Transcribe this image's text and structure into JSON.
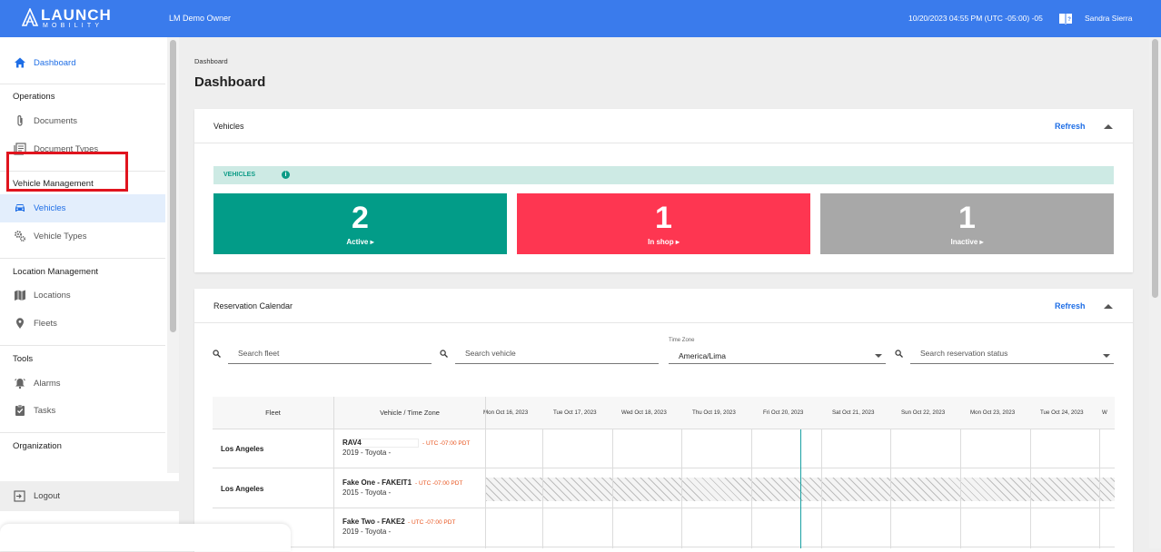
{
  "header": {
    "logo_word": "LAUNCH",
    "logo_sub": "MOBILITY",
    "org": "LM Demo Owner",
    "datetime": "10/20/2023 04:55 PM (UTC -05:00) -05",
    "user": "Sandra Sierra",
    "help_icon": "book-help-icon"
  },
  "sidebar": {
    "dashboard": "Dashboard",
    "sections": {
      "operations": "Operations",
      "vehicle_management": "Vehicle Management",
      "location_management": "Location Management",
      "tools": "Tools",
      "organization": "Organization"
    },
    "items": {
      "documents": "Documents",
      "document_types": "Document Types",
      "vehicles": "Vehicles",
      "vehicle_types": "Vehicle Types",
      "locations": "Locations",
      "fleets": "Fleets",
      "alarms": "Alarms",
      "tasks": "Tasks"
    },
    "logout": "Logout",
    "active": "Vehicles"
  },
  "main": {
    "breadcrumb": "Dashboard",
    "title": "Dashboard",
    "vehicles_card": {
      "title": "Vehicles",
      "refresh": "Refresh",
      "banner": "VEHICLES",
      "stats": [
        {
          "value": "2",
          "label": "Active",
          "color": "#029c88"
        },
        {
          "value": "1",
          "label": "In shop",
          "color": "#fe3651"
        },
        {
          "value": "1",
          "label": "Inactive",
          "color": "#a8a8a8"
        }
      ]
    },
    "calendar_card": {
      "title": "Reservation Calendar",
      "refresh": "Refresh",
      "search_fleet_placeholder": "Search fleet",
      "search_vehicle_placeholder": "Search vehicle",
      "time_zone_label": "Time Zone",
      "time_zone_value": "America/Lima",
      "search_status_placeholder": "Search reservation status",
      "columns": {
        "fleet": "Fleet",
        "vehicle": "Vehicle / Time Zone"
      },
      "days": [
        "Mon Oct 16, 2023",
        "Tue Oct 17, 2023",
        "Wed Oct 18, 2023",
        "Thu Oct 19, 2023",
        "Fri Oct 20, 2023",
        "Sat Oct 21, 2023",
        "Sun Oct 22, 2023",
        "Mon Oct 23, 2023",
        "Tue Oct 24, 2023",
        "W"
      ],
      "rows": [
        {
          "fleet": "Los Angeles",
          "vehicle": "RAV4",
          "tz": "- UTC -07:00 PDT",
          "sub": "2019 - Toyota -"
        },
        {
          "fleet": "Los Angeles",
          "vehicle": "Fake One - FAKEIT1",
          "tz": "- UTC -07:00 PDT",
          "sub": "2015 - Toyota -"
        },
        {
          "fleet": "",
          "vehicle": "Fake Two - FAKE2",
          "tz": "- UTC -07:00 PDT",
          "sub": "2019 - Toyota -"
        }
      ]
    }
  }
}
